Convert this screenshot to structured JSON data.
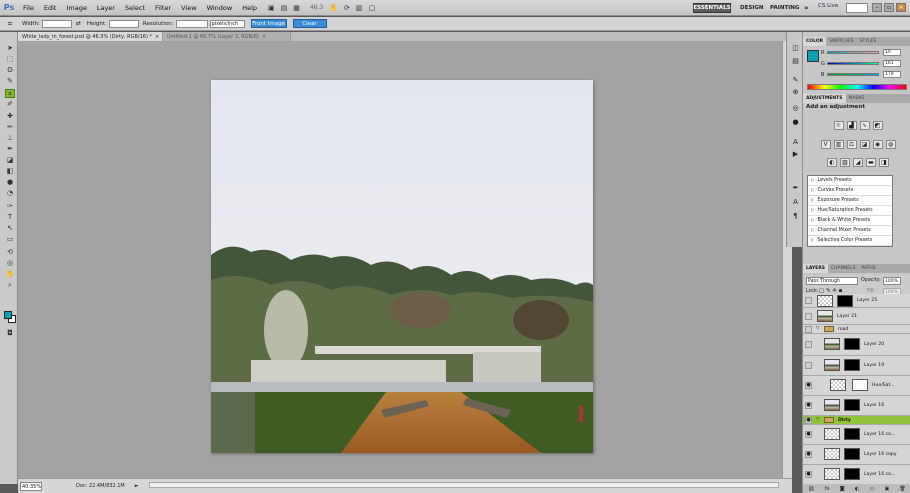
{
  "menubar": {
    "logo": "Ps",
    "items": [
      "File",
      "Edit",
      "Image",
      "Layer",
      "Select",
      "Filter",
      "View",
      "Window",
      "Help"
    ],
    "zoom_display": "46.3",
    "workspaces": {
      "essentials": "ESSENTIALS",
      "design": "DESIGN",
      "painting": "PAINTING",
      "more": "»"
    },
    "cs_live": "CS Live"
  },
  "options_bar": {
    "width_label": "Width:",
    "height_label": "Height:",
    "resolution_label": "Resolution:",
    "units": "pixels/inch",
    "front_image_btn": "Front Image",
    "clear_btn": "Clear"
  },
  "tabs": [
    {
      "label": "White_lady_in_forest.psd @ 46.3% (Dirty, RGB/16) *",
      "close": "×"
    },
    {
      "label": "Untitled-1 @ 66.7% (Layer 3, RGB/8)",
      "close": "×"
    }
  ],
  "status": {
    "zoom": "40.35%",
    "doc": "Doc: 22.4M/832.1M",
    "arrow": "►"
  },
  "color_panel": {
    "tabs": [
      "COLOR",
      "SWATCHES",
      "STYLES"
    ],
    "fg_color": "#0aa1b3",
    "r_label": "R",
    "r_value": "10",
    "g_label": "G",
    "g_value": "161",
    "b_label": "B",
    "b_value": "179"
  },
  "adjustments_panel": {
    "tabs": [
      "ADJUSTMENTS",
      "MASKS"
    ],
    "heading": "Add an adjustment",
    "presets": [
      "Levels Presets",
      "Curves Presets",
      "Exposure Presets",
      "Hue/Saturation Presets",
      "Black & White Presets",
      "Channel Mixer Presets",
      "Selective Color Presets"
    ]
  },
  "layers_panel": {
    "tabs": [
      "LAYERS",
      "CHANNELS",
      "PATHS"
    ],
    "blend_mode": "Pass Through",
    "opacity_label": "Opacity:",
    "opacity": "100%",
    "lock_label": "Lock:",
    "fill_label": "Fill:",
    "fill": "100%",
    "layers": [
      {
        "name": "Layer 25"
      },
      {
        "name": "Layer 21"
      },
      {
        "name": "road"
      },
      {
        "name": "Layer 20"
      },
      {
        "name": "Layer 19"
      },
      {
        "name": "Hue/Sat..."
      },
      {
        "name": "Layer 16"
      },
      {
        "name": "Dirty"
      },
      {
        "name": "Layer 16 co..."
      },
      {
        "name": "Layer 16 copy"
      },
      {
        "name": "Layer 16 co..."
      }
    ]
  }
}
